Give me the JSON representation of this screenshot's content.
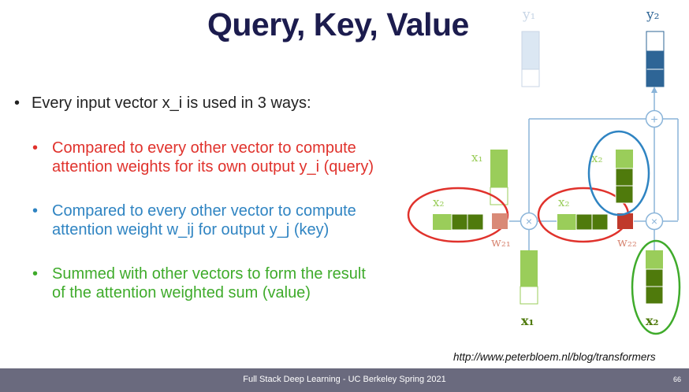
{
  "slide": {
    "title": "Query, Key, Value",
    "main_bullet": "Every input vector x_i is used in 3 ways:",
    "sub_bullets": [
      {
        "text_line1": "Compared to every other vector to compute",
        "text_line2": "attention weights for its own output y_i (query)",
        "color": "#e0322c"
      },
      {
        "text_line1": "Compared to every other vector to compute",
        "text_line2": "attention weight w_ij for output y_j (key)",
        "color": "#2f84c2"
      },
      {
        "text_line1": "Summed with other vectors to form the result",
        "text_line2": "of the attention weighted sum (value)",
        "color": "#3fab2b"
      }
    ],
    "source_url": "http://www.peterbloem.nl/blog/transformers",
    "footer": "Full Stack Deep Learning - UC Berkeley Spring 2021",
    "page_number": "66"
  },
  "diagram": {
    "labels": {
      "y1": "y₁",
      "y2": "y₂",
      "x1_top": "x₁",
      "x2_left": "x₂",
      "x2_mid": "x₂",
      "x2_circled": "x₂",
      "w21": "w₂₁",
      "w22": "w₂₂",
      "x1_bottom": "x₁",
      "x2_bottom": "x₂",
      "plus": "+",
      "times": "×"
    },
    "colors": {
      "light_green": "#9acd5a",
      "dark_green": "#4f7a0c",
      "light_blue": "#dbe7f3",
      "dark_blue": "#2e6596",
      "connector": "#8ab4d9",
      "weight_light": "#d98a77",
      "weight_dark": "#c0392b",
      "red_circle": "#e0322c",
      "blue_circle": "#2f84c2",
      "green_circle": "#3fab2b"
    }
  }
}
